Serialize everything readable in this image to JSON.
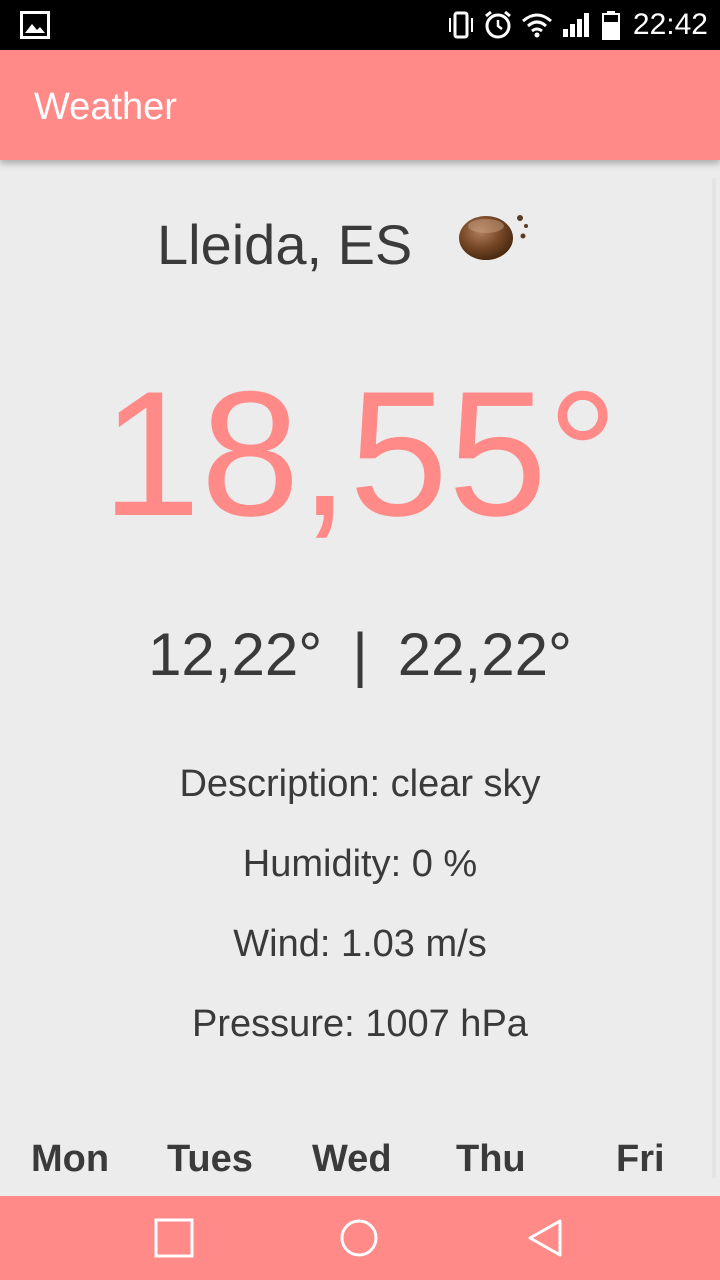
{
  "status_bar": {
    "time": "22:42",
    "icons": [
      "gallery-icon",
      "vibrate-icon",
      "alarm-icon",
      "wifi-icon",
      "signal-icon",
      "battery-icon"
    ]
  },
  "app_bar": {
    "title": "Weather",
    "color": "#ff8a88"
  },
  "current": {
    "city": "Lleida, ES",
    "weather_icon": "clear-night-moon-icon",
    "temperature": "18,55°",
    "min_temp": "12,22°",
    "separator": "|",
    "max_temp": "22,22°",
    "description": "Description: clear sky",
    "humidity": "Humidity: 0 %",
    "wind": "Wind: 1.03 m/s",
    "pressure": "Pressure: 1007 hPa"
  },
  "forecast_days": [
    "Mon",
    "Tues",
    "Wed",
    "Thu",
    "Fri"
  ],
  "nav_bar": {
    "buttons": [
      "recents-icon",
      "home-icon",
      "back-icon"
    ]
  }
}
